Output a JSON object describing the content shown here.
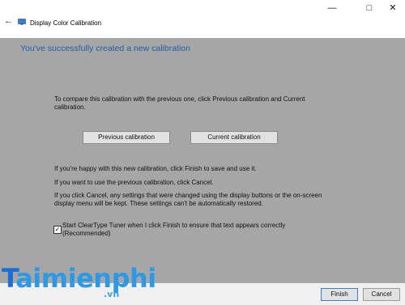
{
  "window": {
    "title": "Display Color Calibration",
    "minimize": "—",
    "maximize": "□",
    "close": "✕",
    "back": "←"
  },
  "header": {
    "title": "You've successfully created a new calibration"
  },
  "main": {
    "intro_line1": "To compare this calibration with the previous one, click Previous calibration and Current",
    "intro_line2": "calibration.",
    "previous_button": "Previous calibration",
    "current_button": "Current calibration",
    "happy_text": "If you're happy with this new calibration, click Finish to save and use it.",
    "previous_text": "If you want to use the previous calibration, click Cancel.",
    "cancel_line1": "If you click Cancel, any settings that were changed using the display buttons or the on-screen",
    "cancel_line2": "display menu will be kept. These settings can't be automatically restored.",
    "cleartype_line1": "Start ClearType Tuner when I click Finish to ensure that text appears correctly",
    "cleartype_line2": "(Recommended)",
    "cleartype_checked": true,
    "check_glyph": "✓"
  },
  "footer": {
    "finish": "Finish",
    "cancel": "Cancel"
  },
  "watermark": {
    "part1": "T",
    "part2": "aimienphi",
    "suffix": ".vn"
  },
  "colors": {
    "header_blue": "#1f5fa8",
    "main_gray": "#a6a6a6",
    "footer_gray": "#f0f0f0",
    "watermark_blue": "#2a7bd8"
  }
}
